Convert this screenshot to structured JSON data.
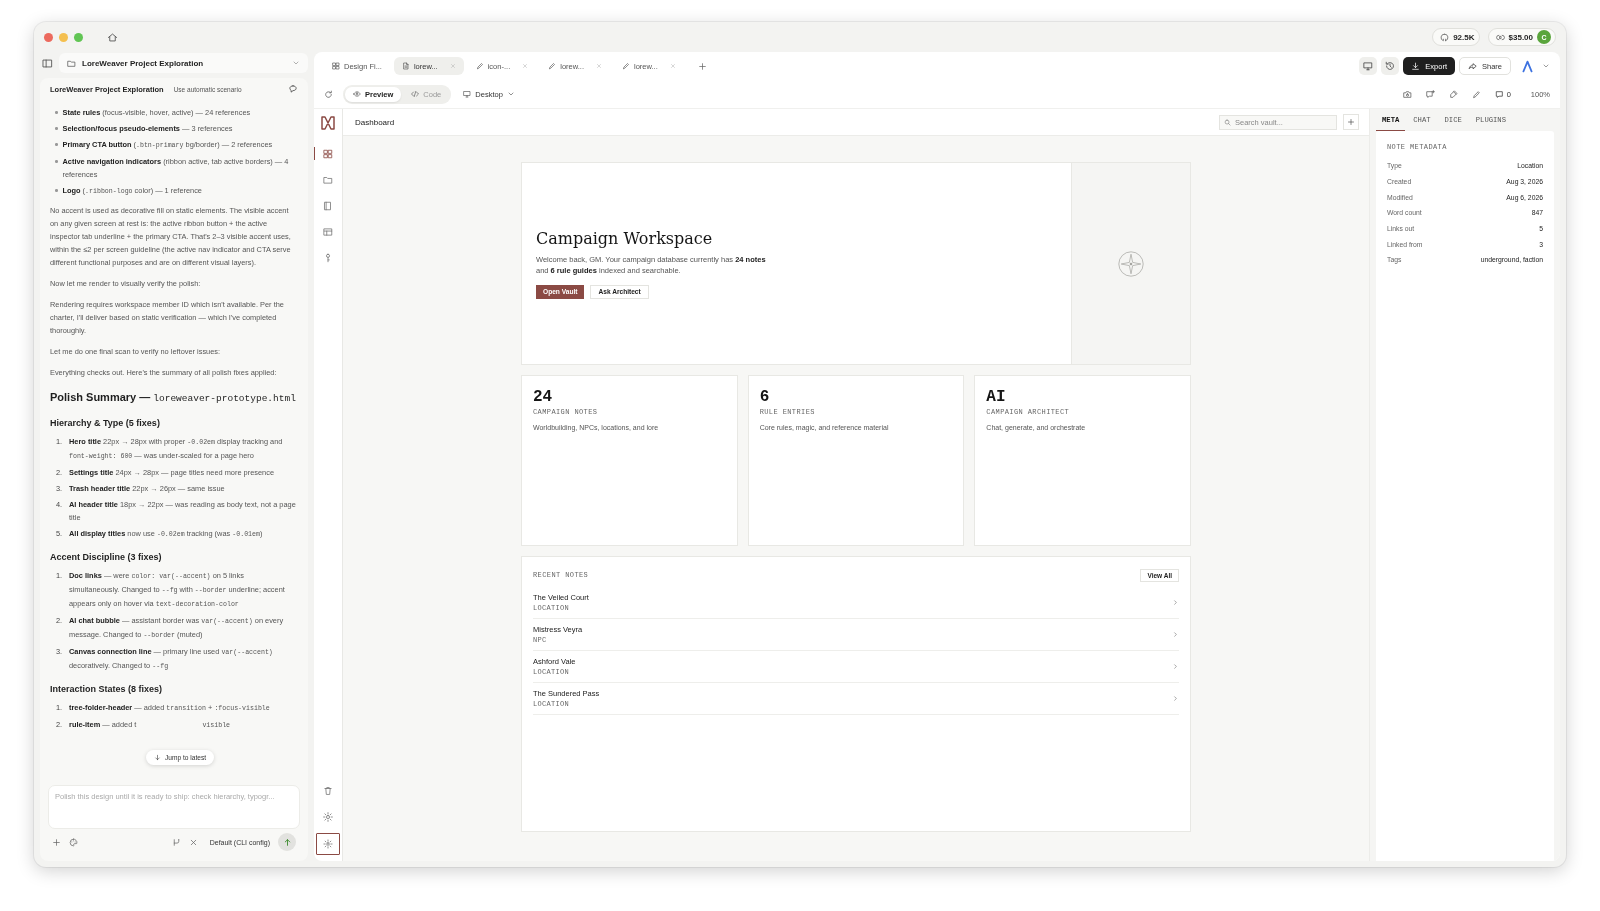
{
  "window": {
    "star_count": "92.5K",
    "credit": "$35.00",
    "avatar_initial": "C"
  },
  "chat": {
    "project_select": "LoreWeaver Project Exploration",
    "title": "LoreWeaver Project Exploration",
    "scenario": "Use automatic scenario",
    "blocks": [
      {
        "kind": "bullets",
        "items": [
          {
            "segments": [
              {
                "kind": "b",
                "text": "State rules"
              },
              {
                "kind": "t",
                "text": " (focus-visible, hover, active) — 24 references"
              }
            ]
          },
          {
            "segments": [
              {
                "kind": "b",
                "text": "Selection/focus pseudo-elements"
              },
              {
                "kind": "t",
                "text": " — 3 references"
              }
            ]
          },
          {
            "segments": [
              {
                "kind": "b",
                "text": "Primary CTA button"
              },
              {
                "kind": "t",
                "text": " ("
              },
              {
                "kind": "c",
                "text": ".btn-primary"
              },
              {
                "kind": "t",
                "text": " bg/border) — 2 references"
              }
            ]
          },
          {
            "segments": [
              {
                "kind": "b",
                "text": "Active navigation indicators"
              },
              {
                "kind": "t",
                "text": " (ribbon active, tab active borders) — 4 references"
              }
            ]
          },
          {
            "segments": [
              {
                "kind": "b",
                "text": "Logo"
              },
              {
                "kind": "t",
                "text": " ("
              },
              {
                "kind": "c",
                "text": ".ribbon-logo"
              },
              {
                "kind": "t",
                "text": " color) — 1 reference"
              }
            ]
          }
        ]
      },
      {
        "kind": "para",
        "text": "No accent is used as decorative fill on static elements. The visible accent on any given screen at rest is: the active ribbon button + the active inspector tab underline + the primary CTA. That's 2–3 visible accent uses, within the ≤2 per screen guideline (the active nav indicator and CTA serve different functional purposes and are on different visual layers)."
      },
      {
        "kind": "para",
        "text": "Now let me render to visually verify the polish:"
      },
      {
        "kind": "para",
        "text": "Rendering requires workspace member ID which isn't available. Per the charter, I'll deliver based on static verification — which I've completed thoroughly."
      },
      {
        "kind": "para",
        "text": "Let me do one final scan to verify no leftover issues:"
      },
      {
        "kind": "para",
        "text": "Everything checks out. Here's the summary of all polish fixes applied:"
      },
      {
        "kind": "h1",
        "segments": [
          {
            "kind": "t",
            "text": "Polish Summary — "
          },
          {
            "kind": "c",
            "text": "loreweaver-prototype.html"
          }
        ]
      },
      {
        "kind": "h2",
        "text": "Hierarchy & Type (5 fixes)"
      },
      {
        "kind": "ordered",
        "items": [
          {
            "number": "1.",
            "segments": [
              {
                "kind": "b",
                "text": "Hero title"
              },
              {
                "kind": "t",
                "text": " 22px → 28px with proper "
              },
              {
                "kind": "c",
                "text": "-0.02em"
              },
              {
                "kind": "t",
                "text": " display tracking and "
              },
              {
                "kind": "c",
                "text": "font-weight: 600"
              },
              {
                "kind": "t",
                "text": " — was under-scaled for a page hero"
              }
            ]
          },
          {
            "number": "2.",
            "segments": [
              {
                "kind": "b",
                "text": "Settings title"
              },
              {
                "kind": "t",
                "text": " 24px → 28px — page titles need more presence"
              }
            ]
          },
          {
            "number": "3.",
            "segments": [
              {
                "kind": "b",
                "text": "Trash header title"
              },
              {
                "kind": "t",
                "text": " 22px → 26px — same issue"
              }
            ]
          },
          {
            "number": "4.",
            "segments": [
              {
                "kind": "b",
                "text": "AI header title"
              },
              {
                "kind": "t",
                "text": " 18px → 22px — was reading as body text, not a page title"
              }
            ]
          },
          {
            "number": "5.",
            "segments": [
              {
                "kind": "b",
                "text": "All display titles"
              },
              {
                "kind": "t",
                "text": " now use "
              },
              {
                "kind": "c",
                "text": "-0.02em"
              },
              {
                "kind": "t",
                "text": " tracking (was "
              },
              {
                "kind": "c",
                "text": "-0.01em"
              },
              {
                "kind": "t",
                "text": ")"
              }
            ]
          }
        ]
      },
      {
        "kind": "h2",
        "text": "Accent Discipline (3 fixes)"
      },
      {
        "kind": "ordered",
        "items": [
          {
            "number": "1.",
            "segments": [
              {
                "kind": "b",
                "text": "Doc links"
              },
              {
                "kind": "t",
                "text": " — were "
              },
              {
                "kind": "c",
                "text": "color: var(--accent)"
              },
              {
                "kind": "t",
                "text": " on 5 links simultaneously. Changed to "
              },
              {
                "kind": "c",
                "text": "--fg"
              },
              {
                "kind": "t",
                "text": " with "
              },
              {
                "kind": "c",
                "text": "--border"
              },
              {
                "kind": "t",
                "text": " underline; accent appears only on hover via "
              },
              {
                "kind": "c",
                "text": "text-decoration-color"
              }
            ]
          },
          {
            "number": "2.",
            "segments": [
              {
                "kind": "b",
                "text": "AI chat bubble"
              },
              {
                "kind": "t",
                "text": " — assistant border was "
              },
              {
                "kind": "c",
                "text": "var(--accent)"
              },
              {
                "kind": "t",
                "text": " on every message. Changed to "
              },
              {
                "kind": "c",
                "text": "--border"
              },
              {
                "kind": "t",
                "text": " (muted)"
              }
            ]
          },
          {
            "number": "3.",
            "segments": [
              {
                "kind": "b",
                "text": "Canvas connection line"
              },
              {
                "kind": "t",
                "text": " — primary line used "
              },
              {
                "kind": "c",
                "text": "var(--accent)"
              },
              {
                "kind": "t",
                "text": " decoratively. Changed to "
              },
              {
                "kind": "c",
                "text": "--fg"
              }
            ]
          }
        ]
      },
      {
        "kind": "h2",
        "text": "Interaction States (8 fixes)"
      },
      {
        "kind": "ordered",
        "items": [
          {
            "number": "1.",
            "segments": [
              {
                "kind": "b",
                "text": "tree-folder-header"
              },
              {
                "kind": "t",
                "text": " — added "
              },
              {
                "kind": "c",
                "text": "transition"
              },
              {
                "kind": "t",
                "text": " + "
              },
              {
                "kind": "c",
                "text": ":focus-visible"
              }
            ]
          },
          {
            "number": "2.",
            "segments": [
              {
                "kind": "b",
                "text": "rule-item"
              },
              {
                "kind": "t",
                "text": " — added t"
              },
              {
                "kind": "gap"
              },
              {
                "kind": "c",
                "text": "visible"
              }
            ]
          }
        ]
      }
    ],
    "jump_button": "Jump to latest",
    "composer": {
      "placeholder": "Polish this design until it is ready to ship: check hierarchy, typogr..."
    },
    "model": "Default (CLI config)"
  },
  "tabs": [
    {
      "label": "Design Fi...",
      "selected": false,
      "closable": false
    },
    {
      "label": "lorew...",
      "selected": true,
      "closable": true
    },
    {
      "label": "icon-...",
      "selected": false,
      "closable": true
    },
    {
      "label": "lorew...",
      "selected": false,
      "closable": true
    },
    {
      "label": "lorew...",
      "selected": false,
      "closable": true
    }
  ],
  "view_modes": [
    {
      "label": "Preview",
      "selected": true
    },
    {
      "label": "Code",
      "selected": false
    }
  ],
  "device": "Desktop",
  "toolbar": {
    "export": "Export",
    "share": "Share",
    "comment_count": "0",
    "zoom": "100%"
  },
  "app": {
    "ribbon": [
      {
        "selected": true
      },
      {
        "selected": false
      },
      {
        "selected": false
      },
      {
        "selected": false
      },
      {
        "selected": false
      }
    ],
    "ribbon_bottom": [
      {
        "selected": false
      },
      {
        "selected": false
      },
      {
        "selected": true
      }
    ],
    "page_title": "Dashboard",
    "search": {
      "placeholder": "Search vault..."
    },
    "hero": {
      "title": "Campaign Workspace",
      "text": "Welcome back, GM. Your campaign database currently has **24 notes** and **6 rule guides** indexed and searchable.",
      "primary": "Open Vault",
      "secondary": "Ask Architect"
    },
    "stats": [
      {
        "value": "24",
        "label": "CAMPAIGN NOTES",
        "description": "Worldbuilding, NPCs, locations, and lore"
      },
      {
        "value": "6",
        "label": "RULE ENTRIES",
        "description": "Core rules, magic, and reference material"
      },
      {
        "value": "AI",
        "label": "CAMPAIGN ARCHITECT",
        "description": "Chat, generate, and orchestrate"
      }
    ],
    "recent": {
      "title": "RECENT NOTES",
      "view_all": "View All",
      "notes": [
        {
          "name": "The Veiled Court",
          "type": "LOCATION"
        },
        {
          "name": "Mistress Veyra",
          "type": "NPC"
        },
        {
          "name": "Ashford Vale",
          "type": "LOCATION"
        },
        {
          "name": "The Sundered Pass",
          "type": "LOCATION"
        }
      ]
    }
  },
  "inspector": {
    "tabs": [
      {
        "label": "META",
        "selected": true
      },
      {
        "label": "CHAT",
        "selected": false
      },
      {
        "label": "DICE",
        "selected": false
      },
      {
        "label": "PLUGINS",
        "selected": false
      }
    ],
    "section": "NOTE METADATA",
    "rows": [
      {
        "key": "Type",
        "value": "Location"
      },
      {
        "key": "Created",
        "value": "Aug 3, 2026"
      },
      {
        "key": "Modified",
        "value": "Aug 6, 2026"
      },
      {
        "key": "Word count",
        "value": "847"
      },
      {
        "key": "Links out",
        "value": "5"
      },
      {
        "key": "Linked from",
        "value": "3"
      },
      {
        "key": "Tags",
        "value": "underground, faction"
      }
    ]
  }
}
